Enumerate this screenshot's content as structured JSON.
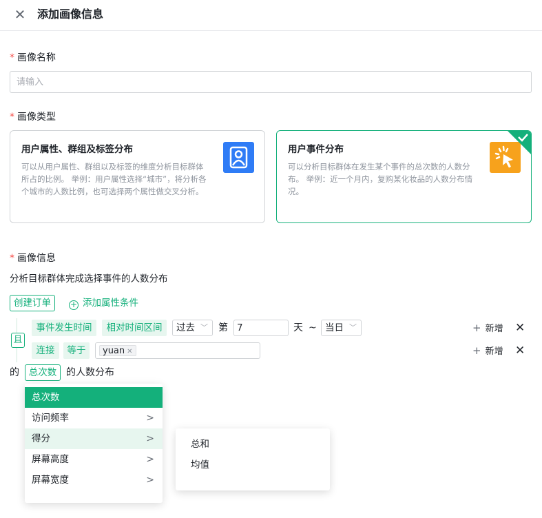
{
  "header": {
    "title": "添加画像信息",
    "close_glyph": "✕"
  },
  "name_section": {
    "required_mark": "*",
    "label": "画像名称",
    "placeholder": "请输入"
  },
  "type_section": {
    "required_mark": "*",
    "label": "画像类型",
    "cards": [
      {
        "title": "用户属性、群组及标签分布",
        "desc": "可以从用户属性、群组以及标签的维度分析目标群体所占的比例。 举例：用户属性选择“城市”，将分析各个城市的人数比例，也可选择两个属性做交叉分析。",
        "icon": "user-badge-icon",
        "selected": false
      },
      {
        "title": "用户事件分布",
        "desc": "可以分析目标群体在发生某个事件的总次数的人数分布。 举例：近一个月内，复购某化妆品的人数分布情况。",
        "icon": "click-cursor-icon",
        "selected": true
      }
    ]
  },
  "info_section": {
    "required_mark": "*",
    "label": "画像信息",
    "subtitle": "分析目标群体完成选择事件的人数分布",
    "event_tag": "创建订单",
    "add_condition": "添加属性条件",
    "logic": "且",
    "conditions": [
      {
        "field": "事件发生时间",
        "operator": "相对时间区间",
        "range_select": "过去",
        "prefix": "第",
        "value": "7",
        "unit": "天",
        "tilde": "~",
        "end_select": "当日",
        "add_label": "新增"
      },
      {
        "field": "连接",
        "operator": "等于",
        "chip": "yuan",
        "add_label": "新增"
      }
    ],
    "result_prefix": "的",
    "metric_tag": "总次数",
    "result_suffix": "的人数分布"
  },
  "metric_menu": {
    "items": [
      "总次数",
      "访问频率",
      "得分",
      "屏幕高度",
      "屏幕宽度"
    ],
    "selected": "总次数",
    "hovered": "得分"
  },
  "submenu": {
    "items": [
      "总和",
      "均值"
    ]
  },
  "colors": {
    "accent": "#14b07b",
    "required": "#f54a45",
    "blue_icon": "#2f7cf6",
    "orange_icon": "#f7a21c"
  }
}
